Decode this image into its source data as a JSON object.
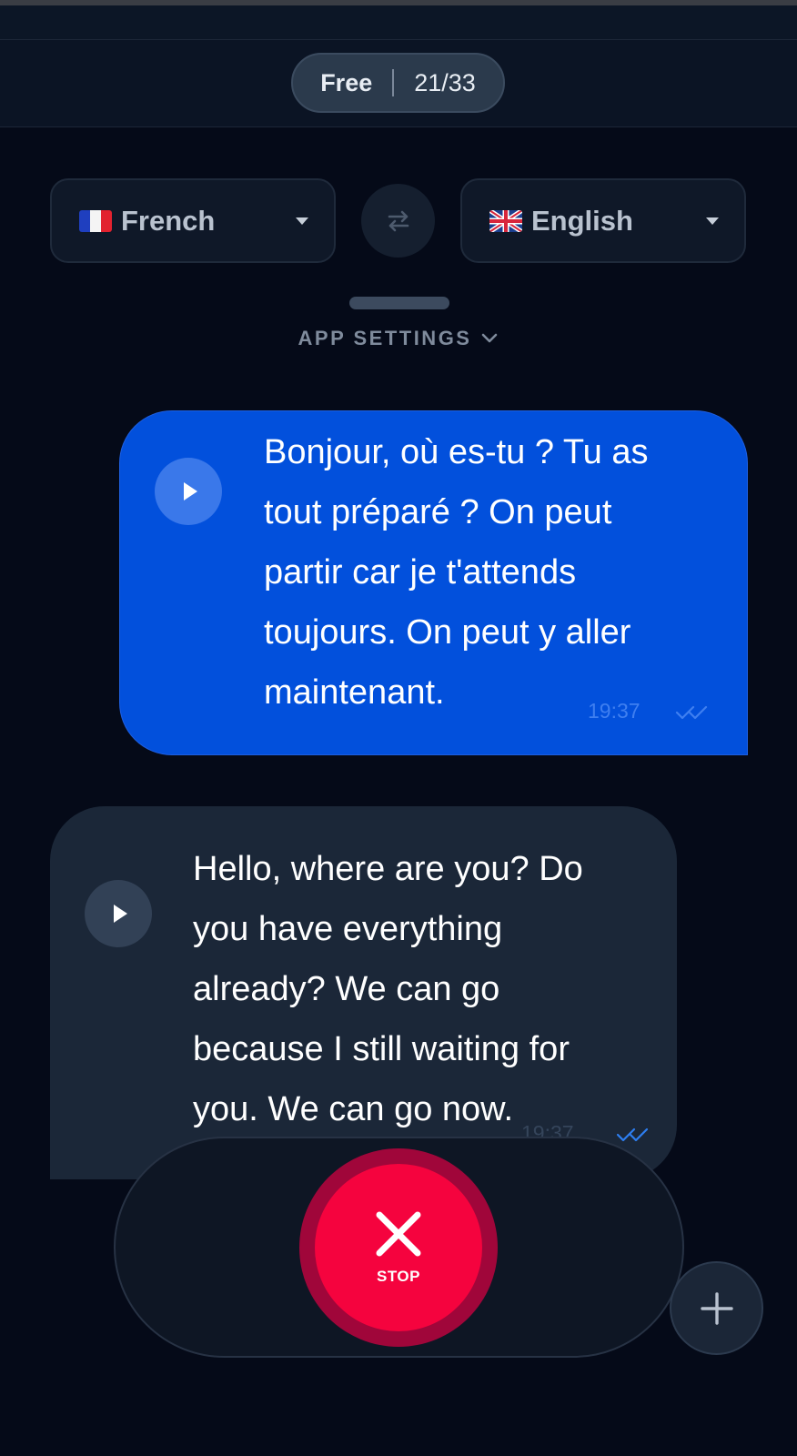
{
  "header": {
    "plan": {
      "label": "Free",
      "usage": "21/33"
    }
  },
  "languages": {
    "source": {
      "name": "French",
      "flag": "flag-france-icon"
    },
    "target": {
      "name": "English",
      "flag": "flag-uk-icon"
    },
    "swap_icon": "swap-arrows-icon"
  },
  "settings": {
    "label": "APP SETTINGS",
    "icon": "chevron-down-icon"
  },
  "messages": [
    {
      "direction": "outgoing",
      "text": "Bonjour, où es-tu ? Tu as tout préparé ? On peut partir car je t'attends toujours. On peut y aller maintenant.",
      "time": "19:37",
      "status_icon": "double-check-icon"
    },
    {
      "direction": "incoming",
      "text": "Hello, where are you? Do you have everything already? We can go because I still waiting for you. We can go now.",
      "time": "19:37",
      "status_icon": "double-check-icon"
    }
  ],
  "controls": {
    "stop_label": "STOP",
    "stop_icon": "close-icon",
    "add_icon": "plus-icon"
  },
  "colors": {
    "background": "#050a18",
    "outgoing_bubble": "#0250dc",
    "incoming_bubble": "#1b2738",
    "stop_button": "#f5033e"
  }
}
